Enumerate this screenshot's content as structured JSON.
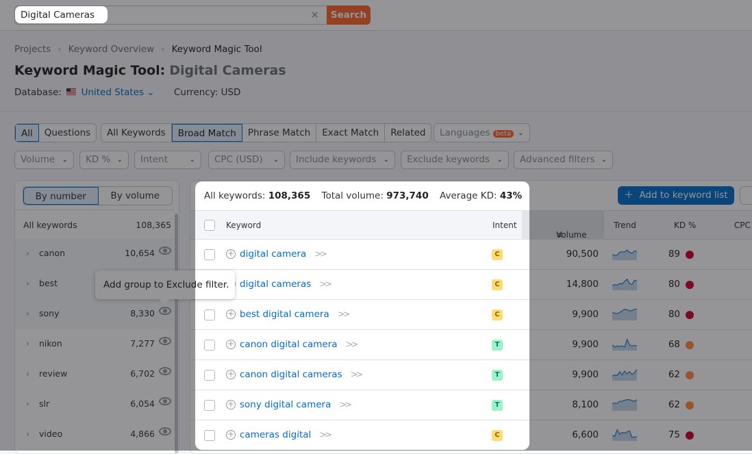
{
  "search": {
    "value": "Digital Cameras",
    "clear_icon": "close-icon",
    "button": "Search"
  },
  "breadcrumb": [
    "Projects",
    "Keyword Overview",
    "Keyword Magic Tool"
  ],
  "title": {
    "tool": "Keyword Magic Tool:",
    "query": "Digital Cameras"
  },
  "database": {
    "label": "Database:",
    "value": "United States",
    "currency": "Currency: USD"
  },
  "tabs1": [
    "All",
    "Questions"
  ],
  "tabs2": [
    "All Keywords",
    "Broad Match",
    "Phrase Match",
    "Exact Match",
    "Related"
  ],
  "languages": {
    "label": "Languages",
    "badge": "beta"
  },
  "filters": [
    "Volume",
    "KD %",
    "Intent",
    "CPC (USD)",
    "Include keywords",
    "Exclude keywords",
    "Advanced filters"
  ],
  "groups": {
    "toggle": [
      "By number",
      "By volume"
    ],
    "all_label": "All keywords",
    "all_count": "108,365",
    "items": [
      {
        "name": "canon",
        "count": "10,654"
      },
      {
        "name": "best",
        "count": ""
      },
      {
        "name": "sony",
        "count": "8,330"
      },
      {
        "name": "nikon",
        "count": "7,277"
      },
      {
        "name": "review",
        "count": "6,702"
      },
      {
        "name": "slr",
        "count": "6,054"
      },
      {
        "name": "video",
        "count": "4,866"
      }
    ]
  },
  "tooltip": "Add group to Exclude filter.",
  "summary": {
    "all_label": "All keywords:",
    "all": "108,365",
    "vol_label": "Total volume:",
    "vol": "973,740",
    "kd_label": "Average KD:",
    "kd": "43%"
  },
  "add_button": "Add to keyword list",
  "columns": {
    "keyword": "Keyword",
    "intent": "Intent",
    "volume": "Volume",
    "trend": "Trend",
    "kd": "KD %",
    "cpc": "CPC"
  },
  "intent_colors": {
    "C": {
      "bg": "#fcdc74",
      "fg": "#9d5b00"
    },
    "T": {
      "bg": "#9ef2c9",
      "fg": "#007c65"
    }
  },
  "kd_colors": {
    "very_hard": "#d1002f",
    "hard": "#ff8c43"
  },
  "rows": [
    {
      "keyword": "digital camera",
      "intent": "C",
      "volume": "90,500",
      "kd": "89",
      "level": "very_hard",
      "trend": [
        0.4,
        0.3,
        0.35,
        0.6,
        0.65,
        0.62,
        0.8,
        0.6,
        0.5,
        0.7,
        0.72
      ]
    },
    {
      "keyword": "digital cameras",
      "intent": "C",
      "volume": "14,800",
      "kd": "80",
      "level": "very_hard",
      "trend": [
        0.3,
        0.4,
        0.35,
        0.5,
        0.45,
        0.7,
        0.9,
        0.5,
        0.4,
        0.8,
        0.75
      ]
    },
    {
      "keyword": "best digital camera",
      "intent": "C",
      "volume": "9,900",
      "kd": "80",
      "level": "very_hard",
      "trend": [
        0.6,
        0.55,
        0.5,
        0.6,
        0.75,
        0.9,
        0.85,
        0.75,
        0.78,
        0.9,
        0.9
      ]
    },
    {
      "keyword": "canon digital camera",
      "intent": "T",
      "volume": "9,900",
      "kd": "68",
      "level": "hard",
      "trend": [
        0.4,
        0.2,
        0.3,
        0.25,
        0.3,
        0.2,
        0.9,
        0.4,
        0.3,
        0.35,
        0.3
      ]
    },
    {
      "keyword": "canon digital cameras",
      "intent": "T",
      "volume": "9,900",
      "kd": "62",
      "level": "hard",
      "trend": [
        0.3,
        0.4,
        0.35,
        0.7,
        0.4,
        0.75,
        0.5,
        0.7,
        0.45,
        0.6,
        0.9
      ]
    },
    {
      "keyword": "sony digital camera",
      "intent": "T",
      "volume": "8,100",
      "kd": "62",
      "level": "hard",
      "trend": [
        0.5,
        0.6,
        0.55,
        0.75,
        0.75,
        0.85,
        0.9,
        0.9,
        0.8,
        0.75,
        0.9
      ]
    },
    {
      "keyword": "cameras digital",
      "intent": "C",
      "volume": "6,600",
      "kd": "75",
      "level": "very_hard",
      "trend": [
        0.4,
        0.3,
        0.9,
        0.5,
        0.65,
        0.6,
        0.7,
        0.8,
        0.2,
        0.25,
        0.25
      ]
    }
  ]
}
